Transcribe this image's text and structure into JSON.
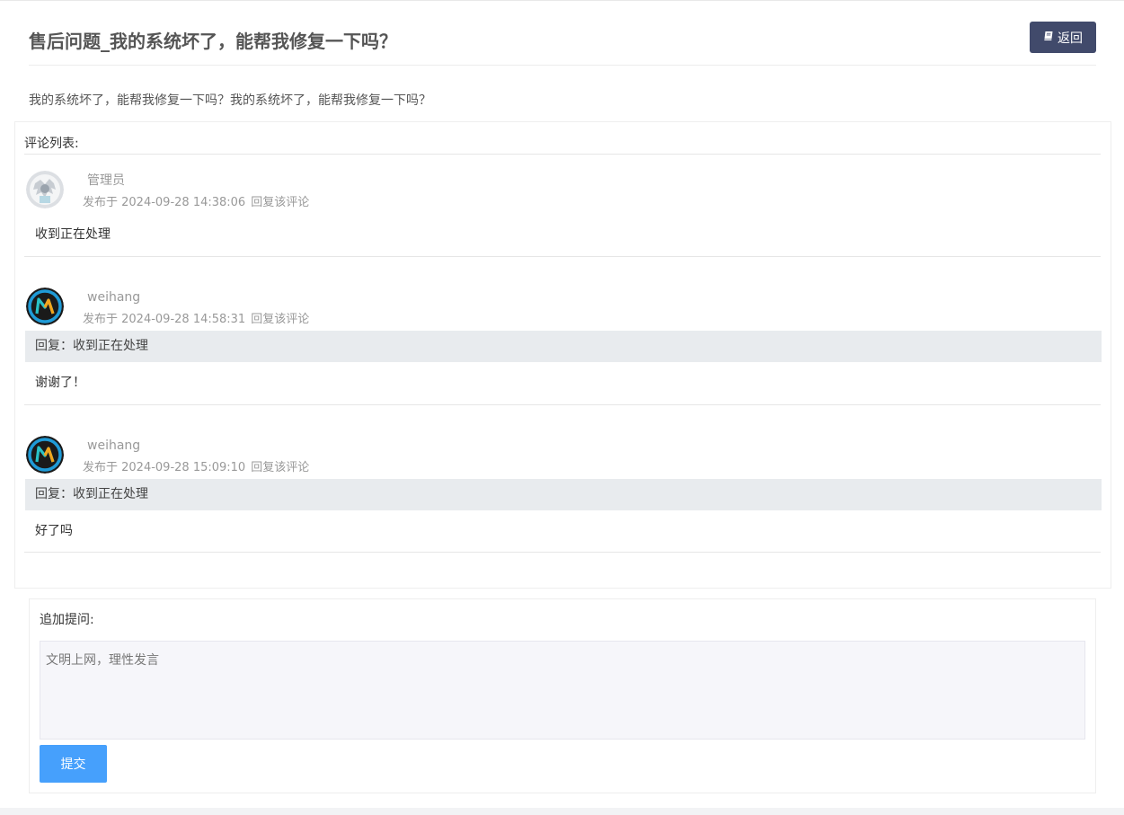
{
  "page": {
    "title": "售后问题_我的系统坏了，能帮我修复一下吗？",
    "body": "我的系统坏了，能帮我修复一下吗？我的系统坏了，能帮我修复一下吗？",
    "back_button": {
      "label": "返回",
      "icon": "book-icon"
    }
  },
  "comments_section": {
    "heading": "评论列表:",
    "comments": [
      {
        "author": "管理员",
        "avatar": "admin-avatar",
        "meta": "发布于 2024-09-28 14:38:06",
        "reply_label": "回复该评论",
        "quote": "",
        "content": "收到正在处理"
      },
      {
        "author": "weihang",
        "avatar": "weihang-avatar",
        "meta": "发布于 2024-09-28 14:58:31",
        "reply_label": "回复该评论",
        "quote": "回复：收到正在处理",
        "content": "谢谢了！"
      },
      {
        "author": "weihang",
        "avatar": "weihang-avatar",
        "meta": "发布于 2024-09-28 15:09:10",
        "reply_label": "回复该评论",
        "quote": "回复：收到正在处理",
        "content": "好了吗"
      }
    ]
  },
  "follow_up": {
    "label": "追加提问:",
    "placeholder": "文明上网，理性发言",
    "value": "",
    "submit_label": "提交"
  },
  "colors": {
    "back_button_bg": "#414a6b",
    "submit_button_bg": "#46a0fc",
    "quote_bg": "#e8ebee",
    "input_bg": "#f6f6fa"
  }
}
